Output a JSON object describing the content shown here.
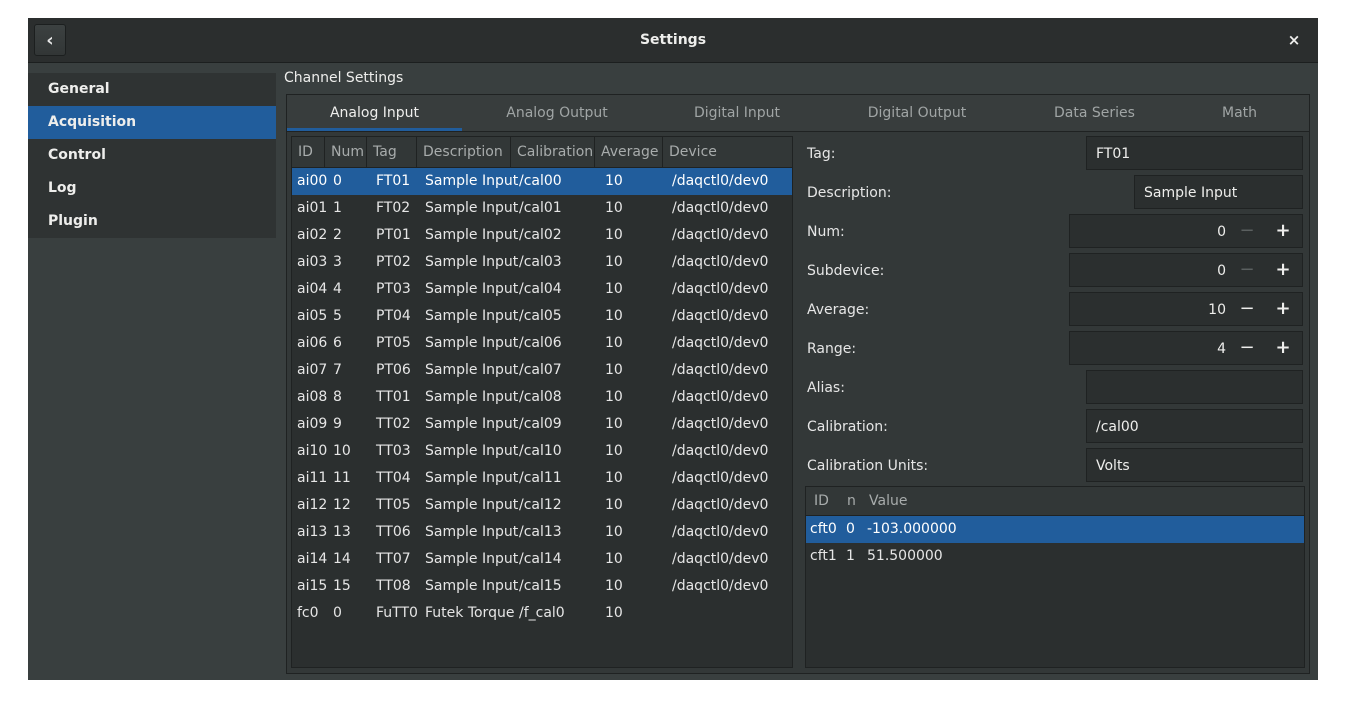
{
  "window": {
    "title": "Settings",
    "back_icon": "‹",
    "close_icon": "×"
  },
  "sidebar": {
    "items": [
      {
        "label": "General",
        "active": false
      },
      {
        "label": "Acquisition",
        "active": true
      },
      {
        "label": "Control",
        "active": false
      },
      {
        "label": "Log",
        "active": false
      },
      {
        "label": "Plugin",
        "active": false
      }
    ]
  },
  "section_title": "Channel Settings",
  "tabs": [
    {
      "label": "Analog Input",
      "active": true
    },
    {
      "label": "Analog Output",
      "active": false
    },
    {
      "label": "Digital Input",
      "active": false
    },
    {
      "label": "Digital Output",
      "active": false
    },
    {
      "label": "Data Series",
      "active": false
    },
    {
      "label": "Math",
      "active": false
    }
  ],
  "channels": {
    "headers": [
      "ID",
      "Num",
      "Tag",
      "Description",
      "Calibration",
      "Average",
      "Device"
    ],
    "rows": [
      [
        "ai00",
        "0",
        "FT01",
        "Sample Input",
        "/cal00",
        "10",
        "/daqctl0/dev0"
      ],
      [
        "ai01",
        "1",
        "FT02",
        "Sample Input",
        "/cal01",
        "10",
        "/daqctl0/dev0"
      ],
      [
        "ai02",
        "2",
        "PT01",
        "Sample Input",
        "/cal02",
        "10",
        "/daqctl0/dev0"
      ],
      [
        "ai03",
        "3",
        "PT02",
        "Sample Input",
        "/cal03",
        "10",
        "/daqctl0/dev0"
      ],
      [
        "ai04",
        "4",
        "PT03",
        "Sample Input",
        "/cal04",
        "10",
        "/daqctl0/dev0"
      ],
      [
        "ai05",
        "5",
        "PT04",
        "Sample Input",
        "/cal05",
        "10",
        "/daqctl0/dev0"
      ],
      [
        "ai06",
        "6",
        "PT05",
        "Sample Input",
        "/cal06",
        "10",
        "/daqctl0/dev0"
      ],
      [
        "ai07",
        "7",
        "PT06",
        "Sample Input",
        "/cal07",
        "10",
        "/daqctl0/dev0"
      ],
      [
        "ai08",
        "8",
        "TT01",
        "Sample Input",
        "/cal08",
        "10",
        "/daqctl0/dev0"
      ],
      [
        "ai09",
        "9",
        "TT02",
        "Sample Input",
        "/cal09",
        "10",
        "/daqctl0/dev0"
      ],
      [
        "ai10",
        "10",
        "TT03",
        "Sample Input",
        "/cal10",
        "10",
        "/daqctl0/dev0"
      ],
      [
        "ai11",
        "11",
        "TT04",
        "Sample Input",
        "/cal11",
        "10",
        "/daqctl0/dev0"
      ],
      [
        "ai12",
        "12",
        "TT05",
        "Sample Input",
        "/cal12",
        "10",
        "/daqctl0/dev0"
      ],
      [
        "ai13",
        "13",
        "TT06",
        "Sample Input",
        "/cal13",
        "10",
        "/daqctl0/dev0"
      ],
      [
        "ai14",
        "14",
        "TT07",
        "Sample Input",
        "/cal14",
        "10",
        "/daqctl0/dev0"
      ],
      [
        "ai15",
        "15",
        "TT08",
        "Sample Input",
        "/cal15",
        "10",
        "/daqctl0/dev0"
      ],
      [
        "fc0",
        "0",
        "FuTT0",
        "Futek Torque",
        "/f_cal0",
        "10",
        ""
      ]
    ],
    "selected_index": 0
  },
  "properties": {
    "tag": {
      "label": "Tag:",
      "value": "FT01"
    },
    "description": {
      "label": "Description:",
      "value": "Sample Input"
    },
    "num": {
      "label": "Num:",
      "value": "0",
      "minus": "−",
      "plus": "+"
    },
    "subdevice": {
      "label": "Subdevice:",
      "value": "0",
      "minus": "−",
      "plus": "+"
    },
    "average": {
      "label": "Average:",
      "value": "10",
      "minus": "−",
      "plus": "+"
    },
    "range": {
      "label": "Range:",
      "value": "4",
      "minus": "−",
      "plus": "+"
    },
    "alias": {
      "label": "Alias:",
      "value": ""
    },
    "calibration": {
      "label": "Calibration:",
      "value": "/cal00"
    },
    "calibration_units": {
      "label": "Calibration Units:",
      "value": "Volts"
    }
  },
  "calibration_table": {
    "headers": [
      "ID",
      "n",
      "Value"
    ],
    "rows": [
      [
        "cft0",
        "0",
        "-103.000000"
      ],
      [
        "cft1",
        "1",
        "51.500000"
      ]
    ],
    "selected_index": 0
  },
  "colors": {
    "accent": "#215d9c",
    "background": "#393f3f",
    "titlebar": "#2b2e2e"
  }
}
